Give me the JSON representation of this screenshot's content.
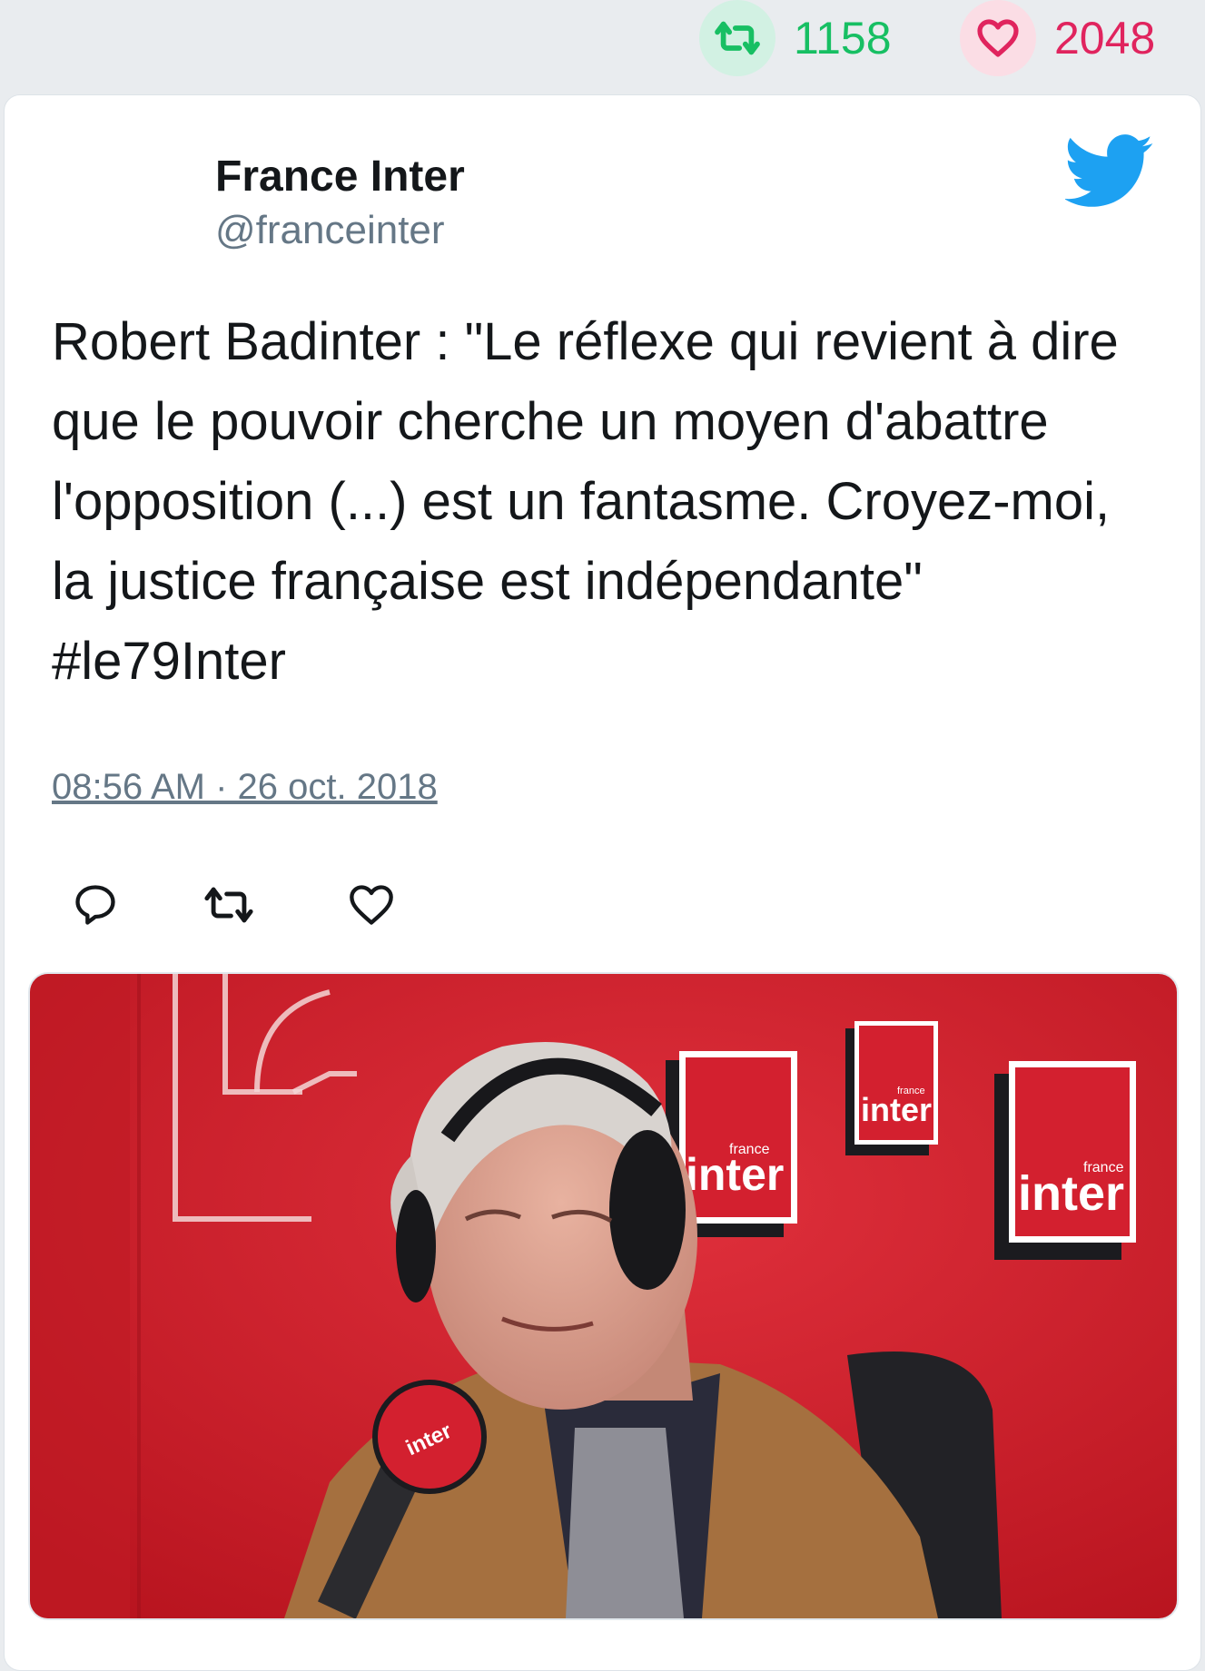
{
  "stats": {
    "retweet_count": "1158",
    "like_count": "2048"
  },
  "tweet": {
    "author_name": "France Inter",
    "author_handle": "@franceinter",
    "text": "Robert Badinter : \"Le réflexe qui revient à dire que le pouvoir cherche un moyen d'abattre l'opposition (...) est un fantasme. Croyez-moi, la justice française est indépendante\" #le79Inter",
    "timestamp": "08:56 AM · 26 oct. 2018"
  },
  "media": {
    "logo_text_small": "france",
    "logo_text_large": "inter"
  },
  "icons": {
    "retweet": "retweet-icon",
    "like": "heart-icon",
    "reply": "reply-icon",
    "brand": "twitter-bird-icon"
  },
  "colors": {
    "retweet": "#17bf63",
    "like": "#e0245e",
    "twitter_blue": "#1da1f2",
    "text": "#14171a",
    "muted": "#657786",
    "studio_red": "#d3202f"
  }
}
